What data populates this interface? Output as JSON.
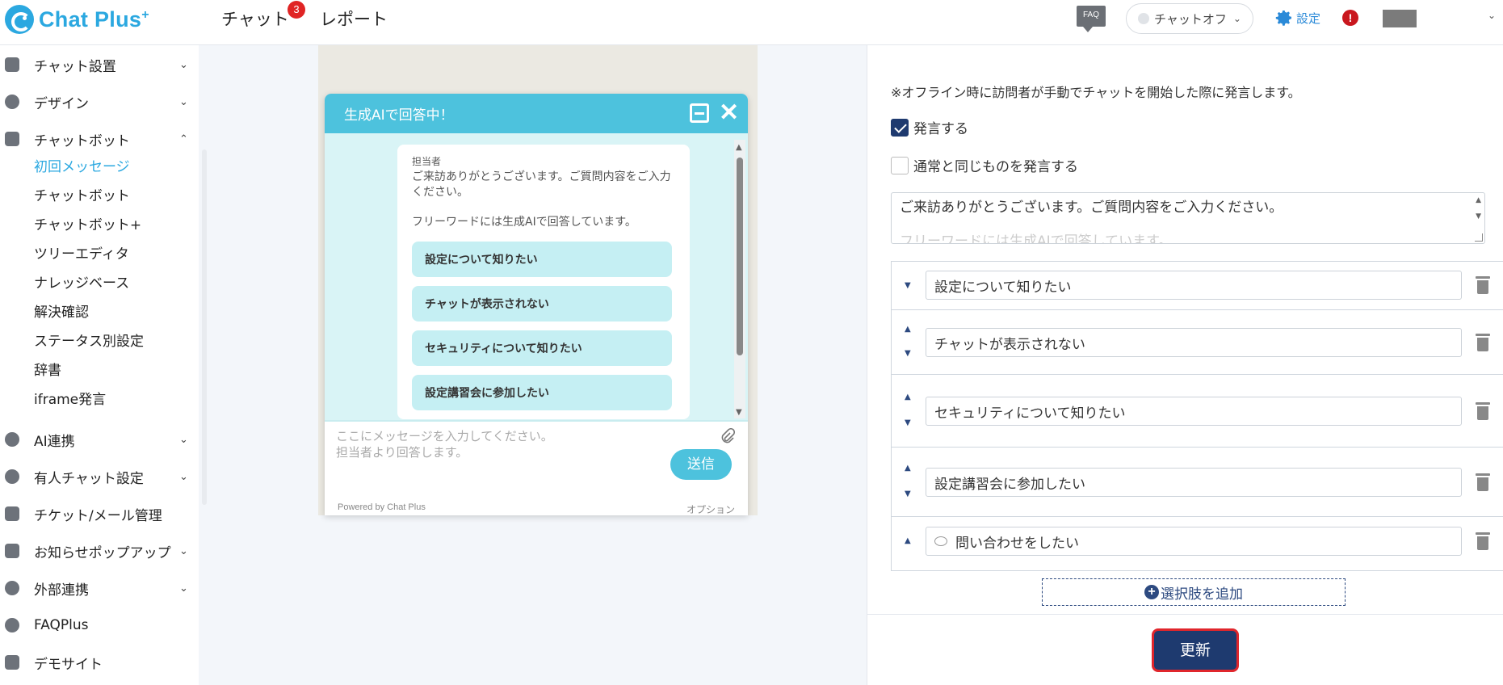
{
  "app": {
    "logo_text": "Chat Plus",
    "logo_plus": "+"
  },
  "topnav": {
    "chat_label": "チャット",
    "chat_badge": "3",
    "report_label": "レポート",
    "faq_label": "FAQ",
    "status_label": "チャットオフ",
    "settings_label": "設定",
    "alert_label": "!"
  },
  "sidebar": {
    "sections": [
      {
        "label": "チャット設置",
        "icon": "tools-icon"
      },
      {
        "label": "デザイン",
        "icon": "palette-icon"
      },
      {
        "label": "チャットボット",
        "icon": "chat-icon"
      }
    ],
    "chatbot_subitems": [
      {
        "label": "初回メッセージ",
        "active": true
      },
      {
        "label": "チャットボット",
        "active": false
      },
      {
        "label": "チャットボット+",
        "active": false
      },
      {
        "label": "ツリーエディタ",
        "active": false
      },
      {
        "label": "ナレッジベース",
        "active": false
      },
      {
        "label": "解決確認",
        "active": false
      },
      {
        "label": "ステータス別設定",
        "active": false
      },
      {
        "label": "辞書",
        "active": false
      },
      {
        "label": "iframe発言",
        "active": false
      }
    ],
    "lower_sections": [
      {
        "label": "AI連携",
        "icon": "bulb-icon",
        "has_chevron": true
      },
      {
        "label": "有人チャット設定",
        "icon": "headset-icon",
        "has_chevron": true
      },
      {
        "label": "チケット/メール管理",
        "icon": "ticket-icon",
        "has_chevron": false
      },
      {
        "label": "お知らせポップアップ",
        "icon": "popup-icon",
        "has_chevron": true
      },
      {
        "label": "外部連携",
        "icon": "share-icon",
        "has_chevron": true
      },
      {
        "label": "FAQPlus",
        "icon": "faq-shield-icon",
        "has_chevron": false
      },
      {
        "label": "デモサイト",
        "icon": "demo-icon",
        "has_chevron": false
      }
    ]
  },
  "preview": {
    "header_title": "生成AIで回答中！",
    "sender": "担当者",
    "message_1": "ご来訪ありがとうございます。ご質問内容をご入力ください。",
    "message_2": "フリーワードには生成AIで回答しています。",
    "options": [
      "設定について知りたい",
      "チャットが表示されない",
      "セキュリティについて知りたい",
      "設定講習会に参加したい"
    ],
    "input_placeholder_1": "ここにメッセージを入力してください。",
    "input_placeholder_2": "担当者より回答します。",
    "send_label": "送信",
    "powered_by": "Powered by Chat Plus",
    "option_label": "オプション"
  },
  "panel": {
    "note": "※オフライン時に訪問者が手動でチャットを開始した際に発言します。",
    "checkbox_speak": {
      "label": "発言する",
      "checked": true
    },
    "checkbox_same": {
      "label": "通常と同じものを発言する",
      "checked": false
    },
    "message_text": "ご来訪ありがとうございます。ご質問内容をご入力ください。",
    "message_text_next": "フリーワードには生成AIで回答しています。",
    "choices": [
      {
        "label": "設定について知りたい"
      },
      {
        "label": "チャットが表示されない"
      },
      {
        "label": "セキュリティについて知りたい"
      },
      {
        "label": "設定講習会に参加したい"
      },
      {
        "label": "問い合わせをしたい"
      }
    ],
    "add_choice_label": "選択肢を追加",
    "update_label": "更新"
  },
  "colors": {
    "brand": "#2ba8e0",
    "widget_header": "#4dc2dd",
    "widget_bg": "#d9f4f6",
    "primary_button": "#1e3a6f",
    "highlight_border": "#e0262c",
    "badge": "#e02424"
  }
}
